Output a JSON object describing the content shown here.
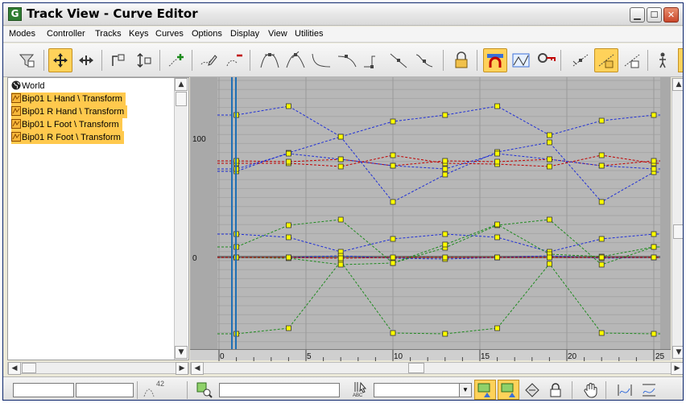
{
  "window": {
    "title": "Track View - Curve Editor",
    "title_icon": "G",
    "minimize": "▁",
    "maximize": "☐",
    "close": "✕"
  },
  "menu": [
    "Modes",
    "Controller",
    "Tracks",
    "Keys",
    "Curves",
    "Options",
    "Display",
    "View",
    "Utilities"
  ],
  "tree": {
    "root": "World",
    "items": [
      "Bip01 L Hand \\ Transform",
      "Bip01 R Hand \\ Transform",
      "Bip01 L Foot \\ Transform",
      "Bip01 R Foot \\ Transform"
    ]
  },
  "graph": {
    "y_labels": [
      "100",
      "0"
    ],
    "frame_labels": [
      "0",
      "5",
      "10",
      "15",
      "20",
      "25"
    ],
    "current_frame": 1,
    "colors": {
      "background": "#b7b7b7",
      "key": "#ffff00",
      "blue": "#1f2fd6",
      "red": "#c00000",
      "green": "#1f8a1f",
      "time_slider": "#1f6fb5"
    }
  },
  "statusbar": {
    "frame_field": "",
    "value_field": "",
    "counter_label": "42",
    "abc_label": "ABC"
  },
  "icons": {
    "toolbar": [
      "filter-icon",
      "move-keys-icon",
      "slide-keys-icon",
      "scale-keys-icon",
      "scale-values-icon",
      "add-keys-icon",
      "draw-curves-icon",
      "reduce-keys-icon",
      "tangent-auto-icon",
      "tangent-custom-icon",
      "tangent-fast-icon",
      "tangent-slow-icon",
      "tangent-step-icon",
      "tangent-linear-icon",
      "tangent-smooth-icon",
      "lock-selection-icon",
      "snap-frames-icon",
      "parameter-out-of-range-icon",
      "show-keyable-icon",
      "lock-tangents-icon",
      "show-tangents-icon",
      "lock-tangents-2-icon",
      "biped-icon"
    ],
    "statusbar": [
      "zoom-selected-icon",
      "filter-selected-icon",
      "selected-keys-icon",
      "show-all-tangents-icon",
      "lock-icon",
      "pan-icon",
      "frame-horizontal-icon",
      "frame-value-icon"
    ]
  }
}
